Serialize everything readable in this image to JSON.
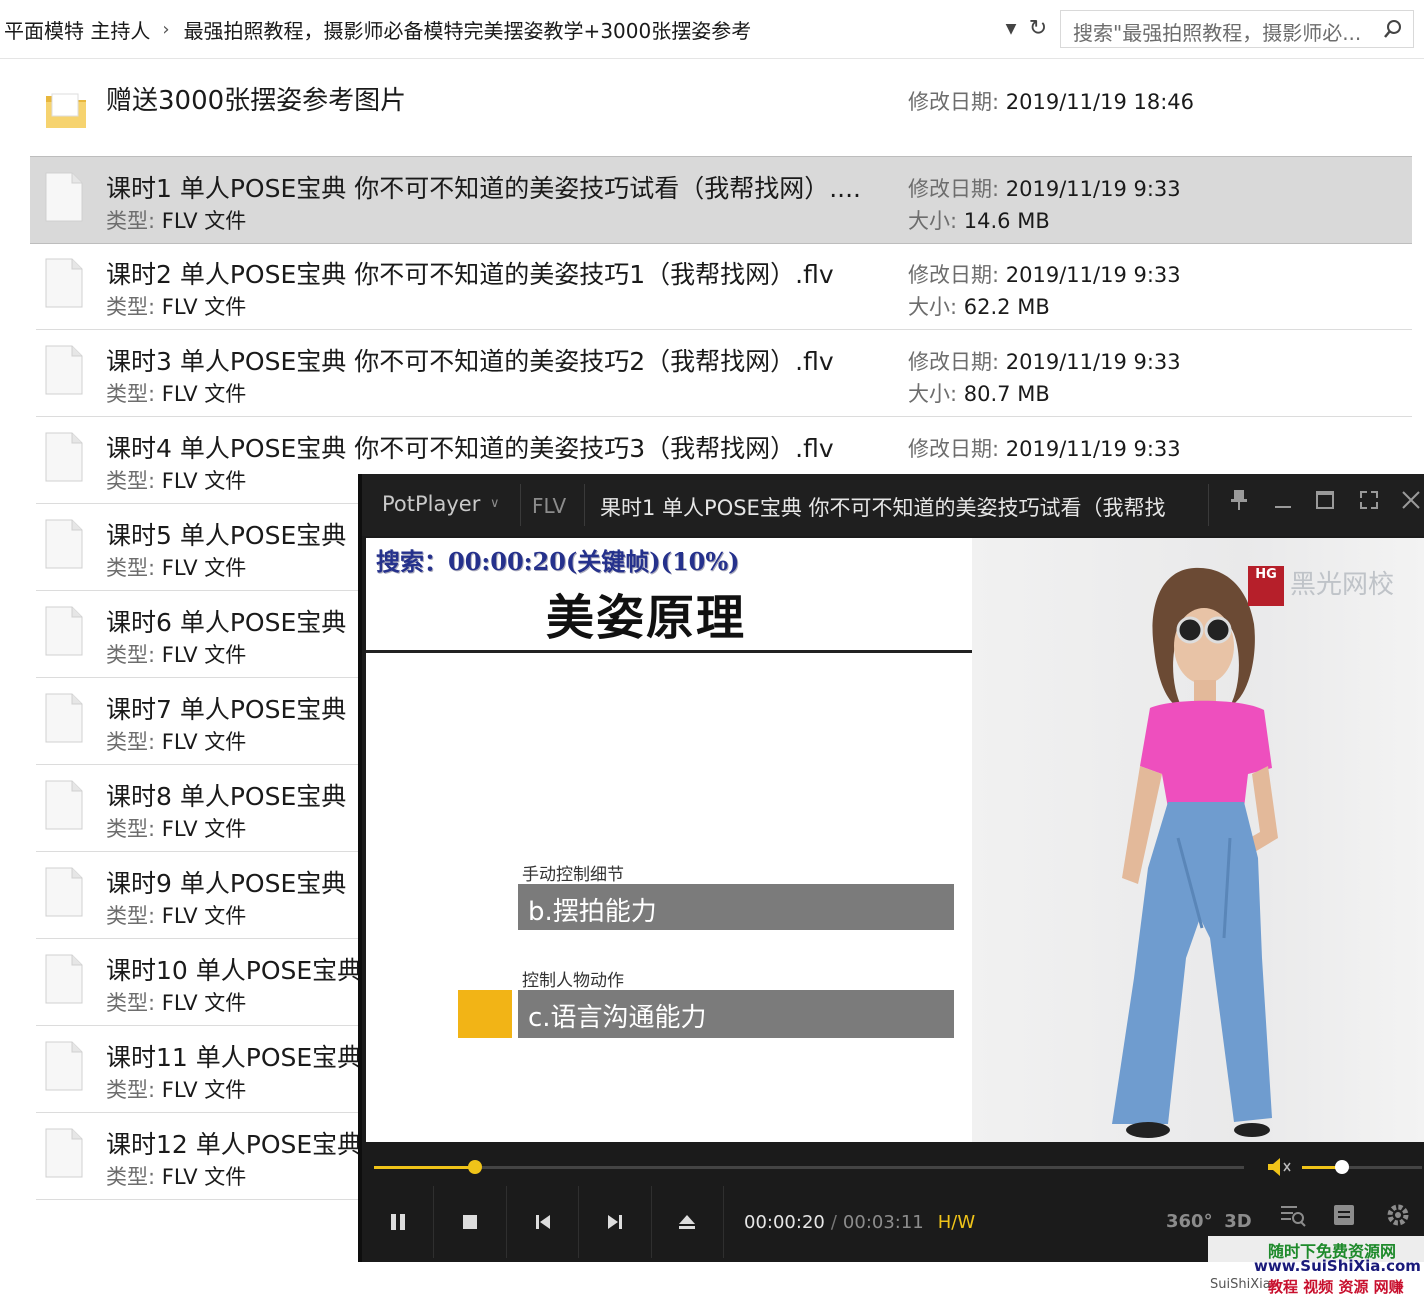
{
  "address": {
    "crumbs": [
      "平面模特 主持人",
      "最强拍照教程，摄影师必备模特完美摆姿教学+3000张摆姿参考"
    ],
    "search_placeholder": "搜索\"最强拍照教程，摄影师必..."
  },
  "labels": {
    "modified": "修改日期: ",
    "size": "大小: ",
    "type": "类型: "
  },
  "folder": {
    "name": "赠送3000张摆姿参考图片",
    "modified": "2019/11/19 18:46"
  },
  "files": [
    {
      "name": "课时1 单人POSE宝典 你不可不知道的美姿技巧试看（我帮找网）....",
      "type": "FLV 文件",
      "modified": "2019/11/19 9:33",
      "size": "14.6 MB",
      "selected": true
    },
    {
      "name": "课时2 单人POSE宝典 你不可不知道的美姿技巧1（我帮找网）.flv",
      "type": "FLV 文件",
      "modified": "2019/11/19 9:33",
      "size": "62.2 MB"
    },
    {
      "name": "课时3 单人POSE宝典 你不可不知道的美姿技巧2（我帮找网）.flv",
      "type": "FLV 文件",
      "modified": "2019/11/19 9:33",
      "size": "80.7 MB"
    },
    {
      "name": "课时4 单人POSE宝典 你不可不知道的美姿技巧3（我帮找网）.flv",
      "type": "FLV 文件",
      "modified": "2019/11/19 9:33"
    },
    {
      "name": "课时5 单人POSE宝典",
      "type": "FLV 文件"
    },
    {
      "name": "课时6 单人POSE宝典",
      "type": "FLV 文件"
    },
    {
      "name": "课时7 单人POSE宝典",
      "type": "FLV 文件"
    },
    {
      "name": "课时8 单人POSE宝典",
      "type": "FLV 文件"
    },
    {
      "name": "课时9 单人POSE宝典",
      "type": "FLV 文件"
    },
    {
      "name": "课时10 单人POSE宝典",
      "type": "FLV 文件"
    },
    {
      "name": "课时11 单人POSE宝典",
      "type": "FLV 文件"
    },
    {
      "name": "课时12 单人POSE宝典",
      "type": "FLV 文件"
    }
  ],
  "player": {
    "brand": "PotPlayer",
    "format": "FLV",
    "title": "果时1 单人POSE宝典 你不可不知道的美姿技巧试看（我帮找",
    "osd": "搜索：00:00:20(关键帧)(10%)",
    "slide": {
      "title": "美姿原理",
      "caption1": "手动控制细节",
      "bar1": "b.摆拍能力",
      "caption2": "控制人物动作",
      "bar2": "c.语言沟通能力",
      "logo_badge": "HG",
      "logo_text": "黑光网校"
    },
    "current_time": "00:00:20",
    "separator": "/",
    "total_time": "00:03:11",
    "decoder": "H/W",
    "progress_fraction": 0.116,
    "volume_fraction": 0.33,
    "right_buttons": [
      "360°",
      "3D"
    ],
    "accent_color": "#f0c419"
  },
  "watermark": {
    "line1": "随时下免费资源网",
    "line2": "www.SuiShiXia.com",
    "line3": "SuiShiXia",
    "line4": "教程 视频 资源 网赚"
  }
}
